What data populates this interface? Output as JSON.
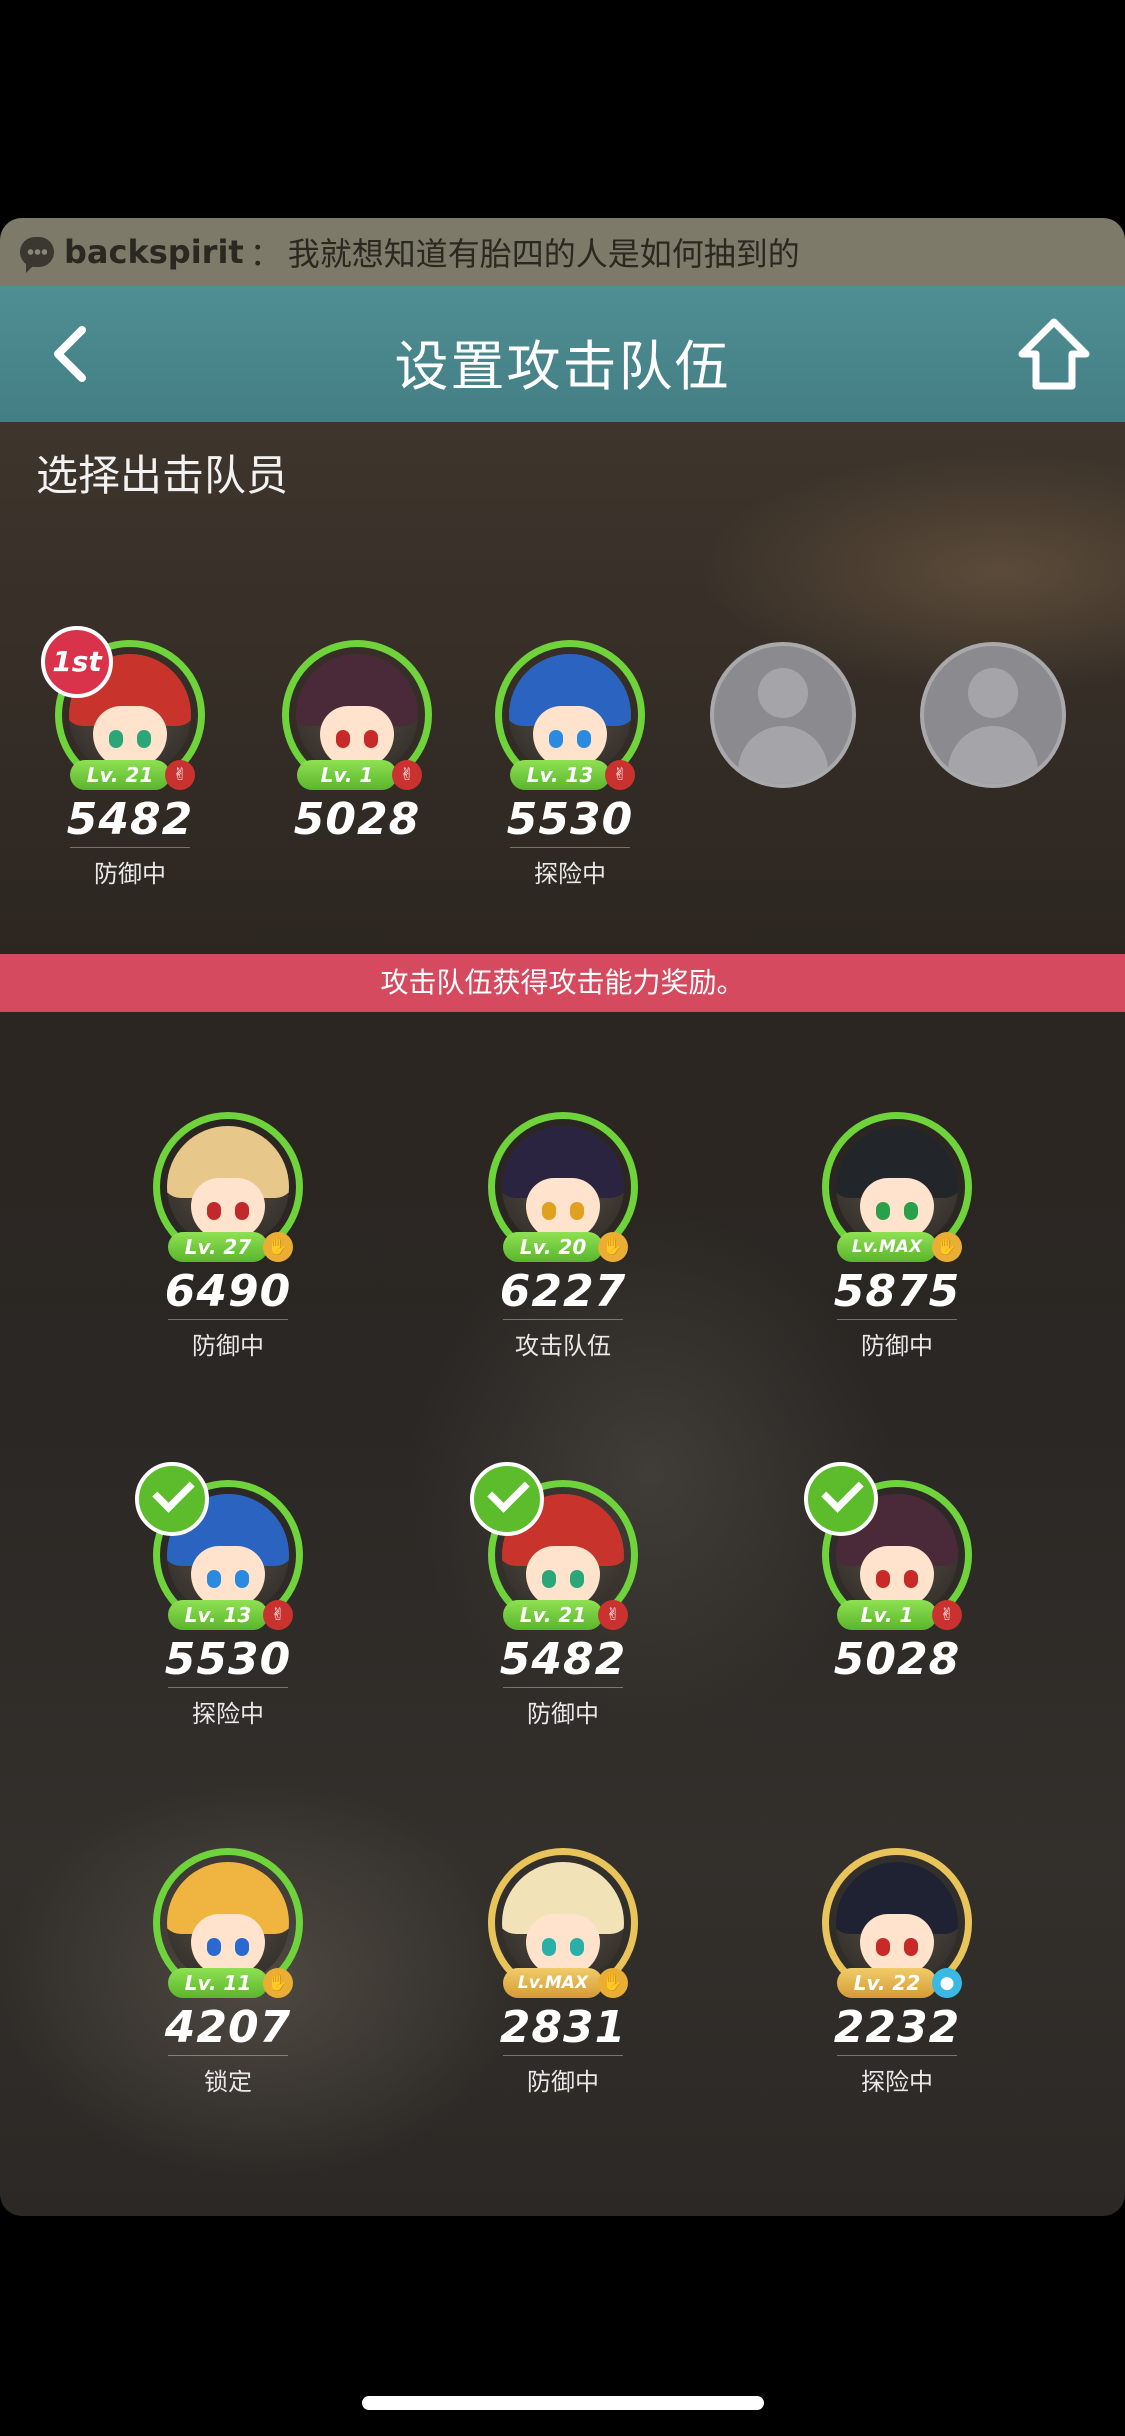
{
  "comment": {
    "user": "backspirit",
    "separator": "：",
    "text": "我就想知道有胎四的人是如何抽到的"
  },
  "header": {
    "title": "设置攻击队伍",
    "back_icon": "chevron-left-icon",
    "home_icon": "home-arrow-icon"
  },
  "team": {
    "section_title": "选择出击队员",
    "rank_label": "1st",
    "members": [
      {
        "level": "Lv. 21",
        "power": "5482",
        "status": "防御中",
        "class_icon": "victory-hand-icon",
        "class_color": "#c9322f",
        "hair": "#c8342c",
        "eye": "#2aa678"
      },
      {
        "level": "Lv. 1",
        "power": "5028",
        "status": "",
        "class_icon": "victory-hand-icon",
        "class_color": "#c9322f",
        "hair": "#4a2a38",
        "eye": "#c82a2a"
      },
      {
        "level": "Lv. 13",
        "power": "5530",
        "status": "探险中",
        "class_icon": "victory-hand-icon",
        "class_color": "#c9322f",
        "hair": "#2a64c0",
        "eye": "#2a8ae0"
      }
    ],
    "empty_slots": 2
  },
  "bonus_banner": "攻击队伍获得攻击能力奖励。",
  "roster": [
    {
      "level": "Lv. 27",
      "power": "6490",
      "status": "防御中",
      "hair": "#e8c78a",
      "eye": "#c02a2a",
      "frame": "green",
      "class": "gold",
      "class_icon": "open-hand-icon",
      "checked": false
    },
    {
      "level": "Lv. 20",
      "power": "6227",
      "status": "攻击队伍",
      "hair": "#2a2440",
      "eye": "#e0a020",
      "frame": "green",
      "class": "gold",
      "class_icon": "open-hand-icon",
      "checked": false
    },
    {
      "level": "Lv.MAX",
      "power": "5875",
      "status": "防御中",
      "hair": "#22262a",
      "eye": "#2aa04a",
      "frame": "green",
      "class": "gold",
      "class_icon": "open-hand-icon",
      "checked": false
    },
    {
      "level": "Lv. 13",
      "power": "5530",
      "status": "探险中",
      "hair": "#2a64c0",
      "eye": "#2a8ae0",
      "frame": "green",
      "class": "red",
      "class_icon": "victory-hand-icon",
      "checked": true
    },
    {
      "level": "Lv. 21",
      "power": "5482",
      "status": "防御中",
      "hair": "#c8342c",
      "eye": "#2aa678",
      "frame": "green",
      "class": "red",
      "class_icon": "victory-hand-icon",
      "checked": true
    },
    {
      "level": "Lv. 1",
      "power": "5028",
      "status": "",
      "hair": "#4a2a38",
      "eye": "#c82a2a",
      "frame": "green",
      "class": "red",
      "class_icon": "victory-hand-icon",
      "checked": true
    },
    {
      "level": "Lv. 11",
      "power": "4207",
      "status": "锁定",
      "hair": "#f0b440",
      "eye": "#2a6ad0",
      "frame": "green",
      "class": "gold",
      "class_icon": "open-hand-icon",
      "checked": false
    },
    {
      "level": "Lv.MAX",
      "power": "2831",
      "status": "防御中",
      "hair": "#f2e2b8",
      "eye": "#2ab0a8",
      "frame": "gold",
      "class": "gold",
      "class_icon": "open-hand-icon",
      "checked": false
    },
    {
      "level": "Lv. 22",
      "power": "2232",
      "status": "探险中",
      "hair": "#1e2232",
      "eye": "#c82a2a",
      "frame": "gold",
      "class": "cyan",
      "class_icon": "orb-icon",
      "checked": false
    }
  ]
}
